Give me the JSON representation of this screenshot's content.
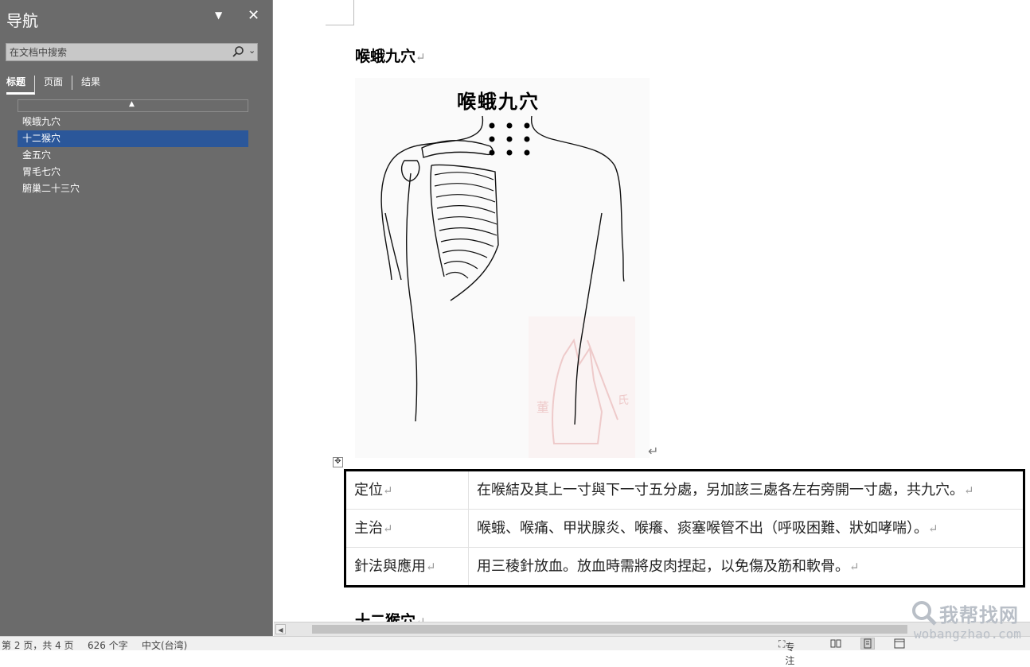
{
  "nav": {
    "title": "导航",
    "search_placeholder": "在文档中搜索",
    "tabs": [
      {
        "label": "标题",
        "active": true
      },
      {
        "label": "页面",
        "active": false
      },
      {
        "label": "结果",
        "active": false
      }
    ],
    "headings": [
      {
        "label": "喉蛾九穴",
        "selected": false
      },
      {
        "label": "十二猴穴",
        "selected": true
      },
      {
        "label": "金五穴",
        "selected": false
      },
      {
        "label": "胃毛七穴",
        "selected": false
      },
      {
        "label": "腑巢二十三穴",
        "selected": false
      }
    ],
    "selected_color": "#2b579a"
  },
  "document": {
    "heading1": "喉蛾九穴",
    "figure_title": "喉蛾九穴",
    "table": [
      {
        "label": "定位",
        "value": "在喉結及其上一寸與下一寸五分處，另加該三處各左右旁開一寸處，共九穴。"
      },
      {
        "label": "主治",
        "value": "喉蛾、喉痛、甲狀腺炎、喉癢、痰塞喉管不出（呼吸困難、狀如哮喘）。"
      },
      {
        "label": "針法與應用",
        "value": "用三稜針放血。放血時需將皮肉捏起，以免傷及筋和軟骨。"
      }
    ],
    "heading2": "十二猴穴",
    "paragraph_mark": "↵"
  },
  "status": {
    "page": "第 2 页，共 4 页",
    "words": "626 个字",
    "language": "中文(台湾)",
    "focus": "专注"
  },
  "watermark": {
    "text": "我帮找网",
    "url": "wobangzhao.com"
  }
}
